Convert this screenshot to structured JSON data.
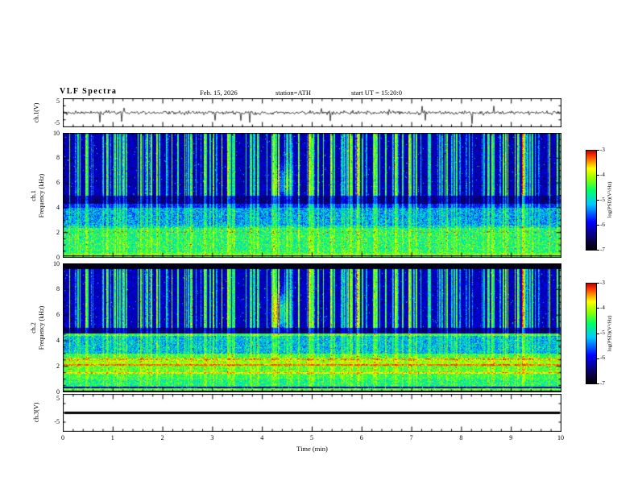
{
  "figure_title": "VLF Spectra",
  "header": {
    "date": "Feb. 15, 2026",
    "station": "station=ATH",
    "start_ut": "start UT =  15:20:0"
  },
  "x_axis": {
    "label": "Time (min)",
    "ticks": [
      "0",
      "1",
      "2",
      "3",
      "4",
      "5",
      "6",
      "7",
      "8",
      "9",
      "10"
    ]
  },
  "panels": {
    "ch1_wave": {
      "ylabel": "ch.1(V)",
      "yticks": [
        "5",
        "-5"
      ]
    },
    "ch1_spec": {
      "ylabel_channel": "ch.1",
      "ylabel_axis": "Frequency (kHz)",
      "yticks": [
        "10",
        "8",
        "6",
        "4",
        "2",
        "0"
      ]
    },
    "ch2_spec": {
      "ylabel_channel": "ch.2",
      "ylabel_axis": "Frequency (kHz)",
      "yticks": [
        "10",
        "8",
        "6",
        "4",
        "2",
        "0"
      ]
    },
    "ch3_wave": {
      "ylabel": "ch.3(V)",
      "yticks": [
        "5",
        "-5"
      ]
    }
  },
  "colorbars": {
    "label": "log(PSD)(V²/Hz)",
    "ticks": [
      "-3",
      "-4",
      "-5",
      "-6",
      "-7"
    ]
  },
  "chart_data": [
    {
      "type": "line",
      "panel": "ch.1 waveform",
      "xlabel": "Time (min)",
      "ylabel": "ch.1(V)",
      "xlim": [
        0,
        10
      ],
      "ylim": [
        -5,
        5
      ],
      "summary": "Broadband receiver output centred on 0 V with roughly ±1 V noise and frequent impulsive sferic spikes reaching about -4 V downward and +3 V upward, distributed over the whole 10-minute record."
    },
    {
      "type": "heatmap",
      "panel": "ch.1 spectrogram",
      "xlabel": "Time (min)",
      "ylabel": "Frequency (kHz)",
      "xlim": [
        0,
        10
      ],
      "ylim": [
        0,
        10
      ],
      "zlabel": "log(PSD)(V²/Hz)",
      "zlim": [
        -7,
        -3
      ],
      "bands": [
        {
          "freq_khz": [
            5,
            10
          ],
          "psd_log": -6.2,
          "note": "blue background crossed by dense vertical sferic streaks reaching about -4.5"
        },
        {
          "freq_khz": [
            4.3,
            5
          ],
          "psd_log": -6.9,
          "note": "dark quiet band"
        },
        {
          "freq_khz": [
            2.5,
            4.3
          ],
          "psd_log": -5.3,
          "note": "cyan band"
        },
        {
          "freq_khz": [
            0.2,
            2.5
          ],
          "psd_log": -4.7,
          "note": "bright green band with yellow speckle"
        },
        {
          "freq_khz": [
            0,
            0.2
          ],
          "psd_log": -6.8,
          "note": "alternating dark/bright edge rows"
        }
      ],
      "events": [
        {
          "time_min": 4.4,
          "freq_khz": 6.1,
          "psd_log": -4.6,
          "note": "localized bright emission patch"
        }
      ]
    },
    {
      "type": "heatmap",
      "panel": "ch.2 spectrogram",
      "xlabel": "Time (min)",
      "ylabel": "Frequency (kHz)",
      "xlim": [
        0,
        10
      ],
      "ylim": [
        0,
        10
      ],
      "zlabel": "log(PSD)(V²/Hz)",
      "zlim": [
        -7,
        -3
      ],
      "bands": [
        {
          "freq_khz": [
            9.6,
            10
          ],
          "psd_log": -7.0,
          "note": "black cutoff band"
        },
        {
          "freq_khz": [
            5,
            9.6
          ],
          "psd_log": -6.1,
          "note": "blue background with vertical sferic streaks"
        },
        {
          "freq_khz": [
            4.6,
            5
          ],
          "psd_log": -6.9,
          "note": "dark quiet band"
        },
        {
          "freq_khz": [
            4.38,
            4.55
          ],
          "psd_log": -4.6,
          "note": "bright green horizontal line"
        },
        {
          "freq_khz": [
            3,
            4.38
          ],
          "psd_log": -5.2,
          "note": "cyan band"
        },
        {
          "freq_khz": [
            1.4,
            3
          ],
          "psd_log": -4.4,
          "note": "yellow-green band with orange/red lines near 1.45, 2.1 and 2.55 kHz at about -3.6"
        },
        {
          "freq_khz": [
            0.4,
            1.4
          ],
          "psd_log": -4.6,
          "note": "green band"
        },
        {
          "freq_khz": [
            0,
            0.4
          ],
          "psd_log": -6.5,
          "note": "dark rows at bottom edge"
        }
      ],
      "events": [
        {
          "time_min": 4.35,
          "freq_khz": 6.3,
          "psd_log": -4.4,
          "note": "bright emission patch"
        }
      ]
    },
    {
      "type": "line",
      "panel": "ch.3 waveform",
      "xlabel": "Time (min)",
      "ylabel": "ch.3(V)",
      "xlim": [
        0,
        10
      ],
      "ylim": [
        -5,
        5
      ],
      "values": "constant 0",
      "summary": "Flat thick trace at 0 V for the whole interval (channel inactive)."
    }
  ]
}
